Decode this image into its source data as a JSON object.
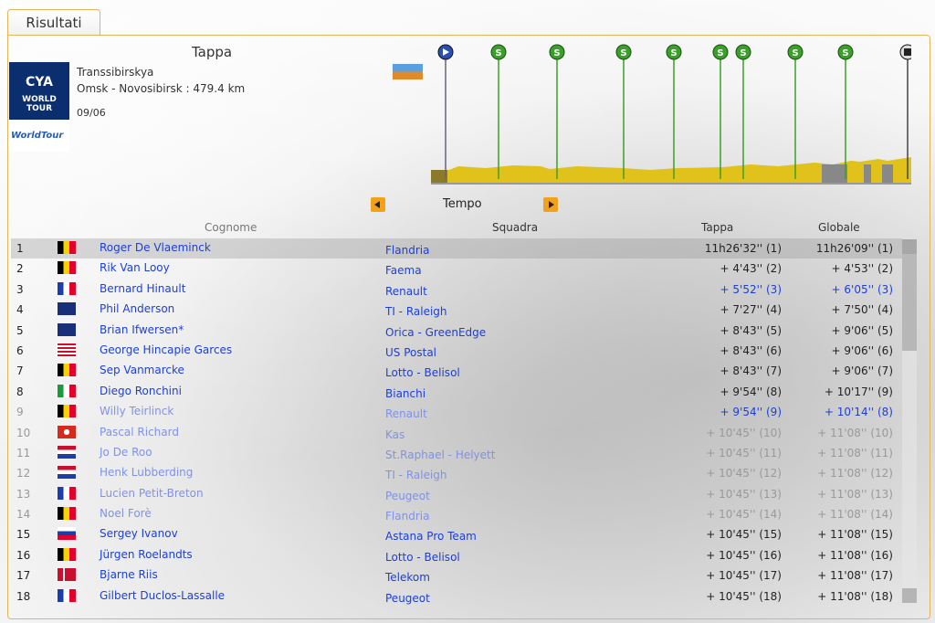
{
  "tab": {
    "label": "Risultati"
  },
  "stage": {
    "title": "Tappa",
    "name": "Transsibirskya",
    "route": "Omsk - Novosibirsk : 479.4 km",
    "date": "09/06",
    "logo": {
      "line1": "CYA",
      "line2": "WORLD",
      "line3": "TOUR",
      "line4": "WorldTour"
    }
  },
  "sort": {
    "label": "Tempo"
  },
  "table": {
    "headers": {
      "cognome": "Cognome",
      "squadra": "Squadra",
      "tappa": "Tappa",
      "globale": "Globale"
    },
    "rows": [
      {
        "pos": "1",
        "name": "Roger De Vlaeminck",
        "team": "Flandria",
        "stage": "11h26'32'' (1)",
        "overall": "11h26'09'' (1)",
        "flag": "be"
      },
      {
        "pos": "2",
        "name": "Rik Van Looy",
        "team": "Faema",
        "stage": "+ 4'43'' (2)",
        "overall": "+ 4'53'' (2)",
        "flag": "be"
      },
      {
        "pos": "3",
        "name": "Bernard Hinault",
        "team": "Renault",
        "stage": "+ 5'52'' (3)",
        "overall": "+ 6'05'' (3)",
        "flag": "fr"
      },
      {
        "pos": "4",
        "name": "Phil Anderson",
        "team": "TI - Raleigh",
        "stage": "+ 7'27'' (4)",
        "overall": "+ 7'50'' (4)",
        "flag": "au"
      },
      {
        "pos": "5",
        "name": "Brian Ifwersen*",
        "team": "Orica - GreenEdge",
        "stage": "+ 8'43'' (5)",
        "overall": "+ 9'06'' (5)",
        "flag": "nz"
      },
      {
        "pos": "6",
        "name": "George Hincapie Garces",
        "team": "US Postal",
        "stage": "+ 8'43'' (6)",
        "overall": "+ 9'06'' (6)",
        "flag": "us"
      },
      {
        "pos": "7",
        "name": "Sep Vanmarcke",
        "team": "Lotto - Belisol",
        "stage": "+ 8'43'' (7)",
        "overall": "+ 9'06'' (7)",
        "flag": "be"
      },
      {
        "pos": "8",
        "name": "Diego Ronchini",
        "team": "Bianchi",
        "stage": "+ 9'54'' (8)",
        "overall": "+ 10'17'' (9)",
        "flag": "it"
      },
      {
        "pos": "9",
        "name": "Willy Teirlinck",
        "team": "Renault",
        "stage": "+ 9'54'' (9)",
        "overall": "+ 10'14'' (8)",
        "flag": "be"
      },
      {
        "pos": "10",
        "name": "Pascal Richard",
        "team": "Kas",
        "stage": "+ 10'45'' (10)",
        "overall": "+ 11'08'' (10)",
        "flag": "ch"
      },
      {
        "pos": "11",
        "name": "Jo De Roo",
        "team": "St.Raphael - Helyett",
        "stage": "+ 10'45'' (11)",
        "overall": "+ 11'08'' (11)",
        "flag": "nl"
      },
      {
        "pos": "12",
        "name": "Henk Lubberding",
        "team": "TI - Raleigh",
        "stage": "+ 10'45'' (12)",
        "overall": "+ 11'08'' (12)",
        "flag": "nl"
      },
      {
        "pos": "13",
        "name": "Lucien Petit-Breton",
        "team": "Peugeot",
        "stage": "+ 10'45'' (13)",
        "overall": "+ 11'08'' (13)",
        "flag": "fr"
      },
      {
        "pos": "14",
        "name": "Noel Forè",
        "team": "Flandria",
        "stage": "+ 10'45'' (14)",
        "overall": "+ 11'08'' (14)",
        "flag": "be"
      },
      {
        "pos": "15",
        "name": "Sergey Ivanov",
        "team": "Astana Pro Team",
        "stage": "+ 10'45'' (15)",
        "overall": "+ 11'08'' (15)",
        "flag": "ru"
      },
      {
        "pos": "16",
        "name": "Jürgen Roelandts",
        "team": "Lotto - Belisol",
        "stage": "+ 10'45'' (16)",
        "overall": "+ 11'08'' (16)",
        "flag": "be"
      },
      {
        "pos": "17",
        "name": "Bjarne Riis",
        "team": "Telekom",
        "stage": "+ 10'45'' (17)",
        "overall": "+ 11'08'' (17)",
        "flag": "dk"
      },
      {
        "pos": "18",
        "name": "Gilbert Duclos-Lassalle",
        "team": "Peugeot",
        "stage": "+ 10'45'' (18)",
        "overall": "+ 11'08'' (18)",
        "flag": "fr"
      }
    ]
  },
  "profile": {
    "markers": [
      "start",
      "sprint",
      "sprint",
      "sprint",
      "sprint",
      "sprint",
      "sprint",
      "sprint",
      "sprint",
      "finish"
    ],
    "sprint_symbol": "S"
  },
  "colors": {
    "accent": "#f2a21a",
    "link": "#1c3fd8",
    "border": "#e3b45a",
    "terrain": "#e0c21a"
  }
}
